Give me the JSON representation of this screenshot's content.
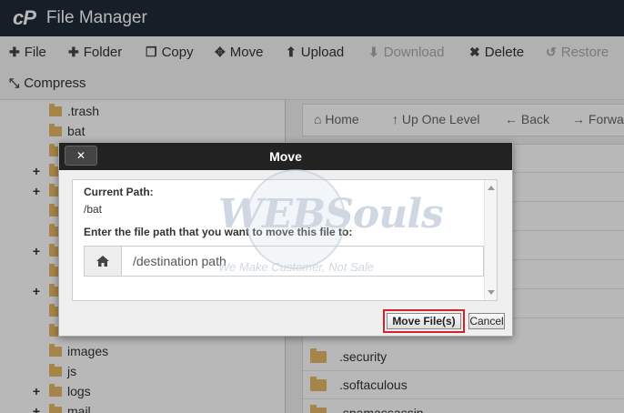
{
  "app": {
    "logo": "cP",
    "title": "File Manager"
  },
  "toolbar": {
    "file": "File",
    "folder": "Folder",
    "copy": "Copy",
    "move": "Move",
    "upload": "Upload",
    "download": "Download",
    "delete": "Delete",
    "restore": "Restore",
    "compress": "Compress"
  },
  "tree": {
    "items": [
      {
        "label": ".trash",
        "expandable": false
      },
      {
        "label": "bat",
        "expandable": false
      },
      {
        "label": "",
        "expandable": false
      },
      {
        "label": "",
        "expandable": true
      },
      {
        "label": "",
        "expandable": true
      },
      {
        "label": "",
        "expandable": false
      },
      {
        "label": "",
        "expandable": false
      },
      {
        "label": "",
        "expandable": true
      },
      {
        "label": "",
        "expandable": false
      },
      {
        "label": "",
        "expandable": true
      },
      {
        "label": "",
        "expandable": false
      },
      {
        "label": "",
        "expandable": false
      },
      {
        "label": "images",
        "expandable": false
      },
      {
        "label": "js",
        "expandable": false
      },
      {
        "label": "logs",
        "expandable": true
      },
      {
        "label": "mail",
        "expandable": true
      }
    ]
  },
  "nav": {
    "home": "Home",
    "up_one_level": "Up One Level",
    "back": "Back",
    "forward": "Forwa"
  },
  "files": [
    ".security",
    ".softaculous",
    ".spamassassin"
  ],
  "dialog": {
    "title": "Move",
    "close_label": "✕",
    "current_path_label": "Current Path:",
    "current_path_value": "/bat",
    "prompt": "Enter the file path that you want to move this file to:",
    "path_value": "/destination path",
    "move_button": "Move File(s)",
    "cancel_button": "Cancel"
  },
  "watermark": {
    "text": "WEBSouls",
    "tagline": "We Make Customer, Not Sale"
  },
  "colors": {
    "header_bg": "#1f2b36",
    "dialog_title_bg": "#222222",
    "highlight_border": "#d3242a",
    "folder": "#e6b968"
  },
  "icons": {
    "home": "home-icon",
    "folder": "folder-icon",
    "plus": "plus-icon",
    "copy": "copy-icon",
    "move": "move-icon",
    "upload": "upload-icon",
    "download": "download-icon",
    "delete": "delete-icon",
    "restore": "restore-icon",
    "compress": "compress-icon"
  }
}
